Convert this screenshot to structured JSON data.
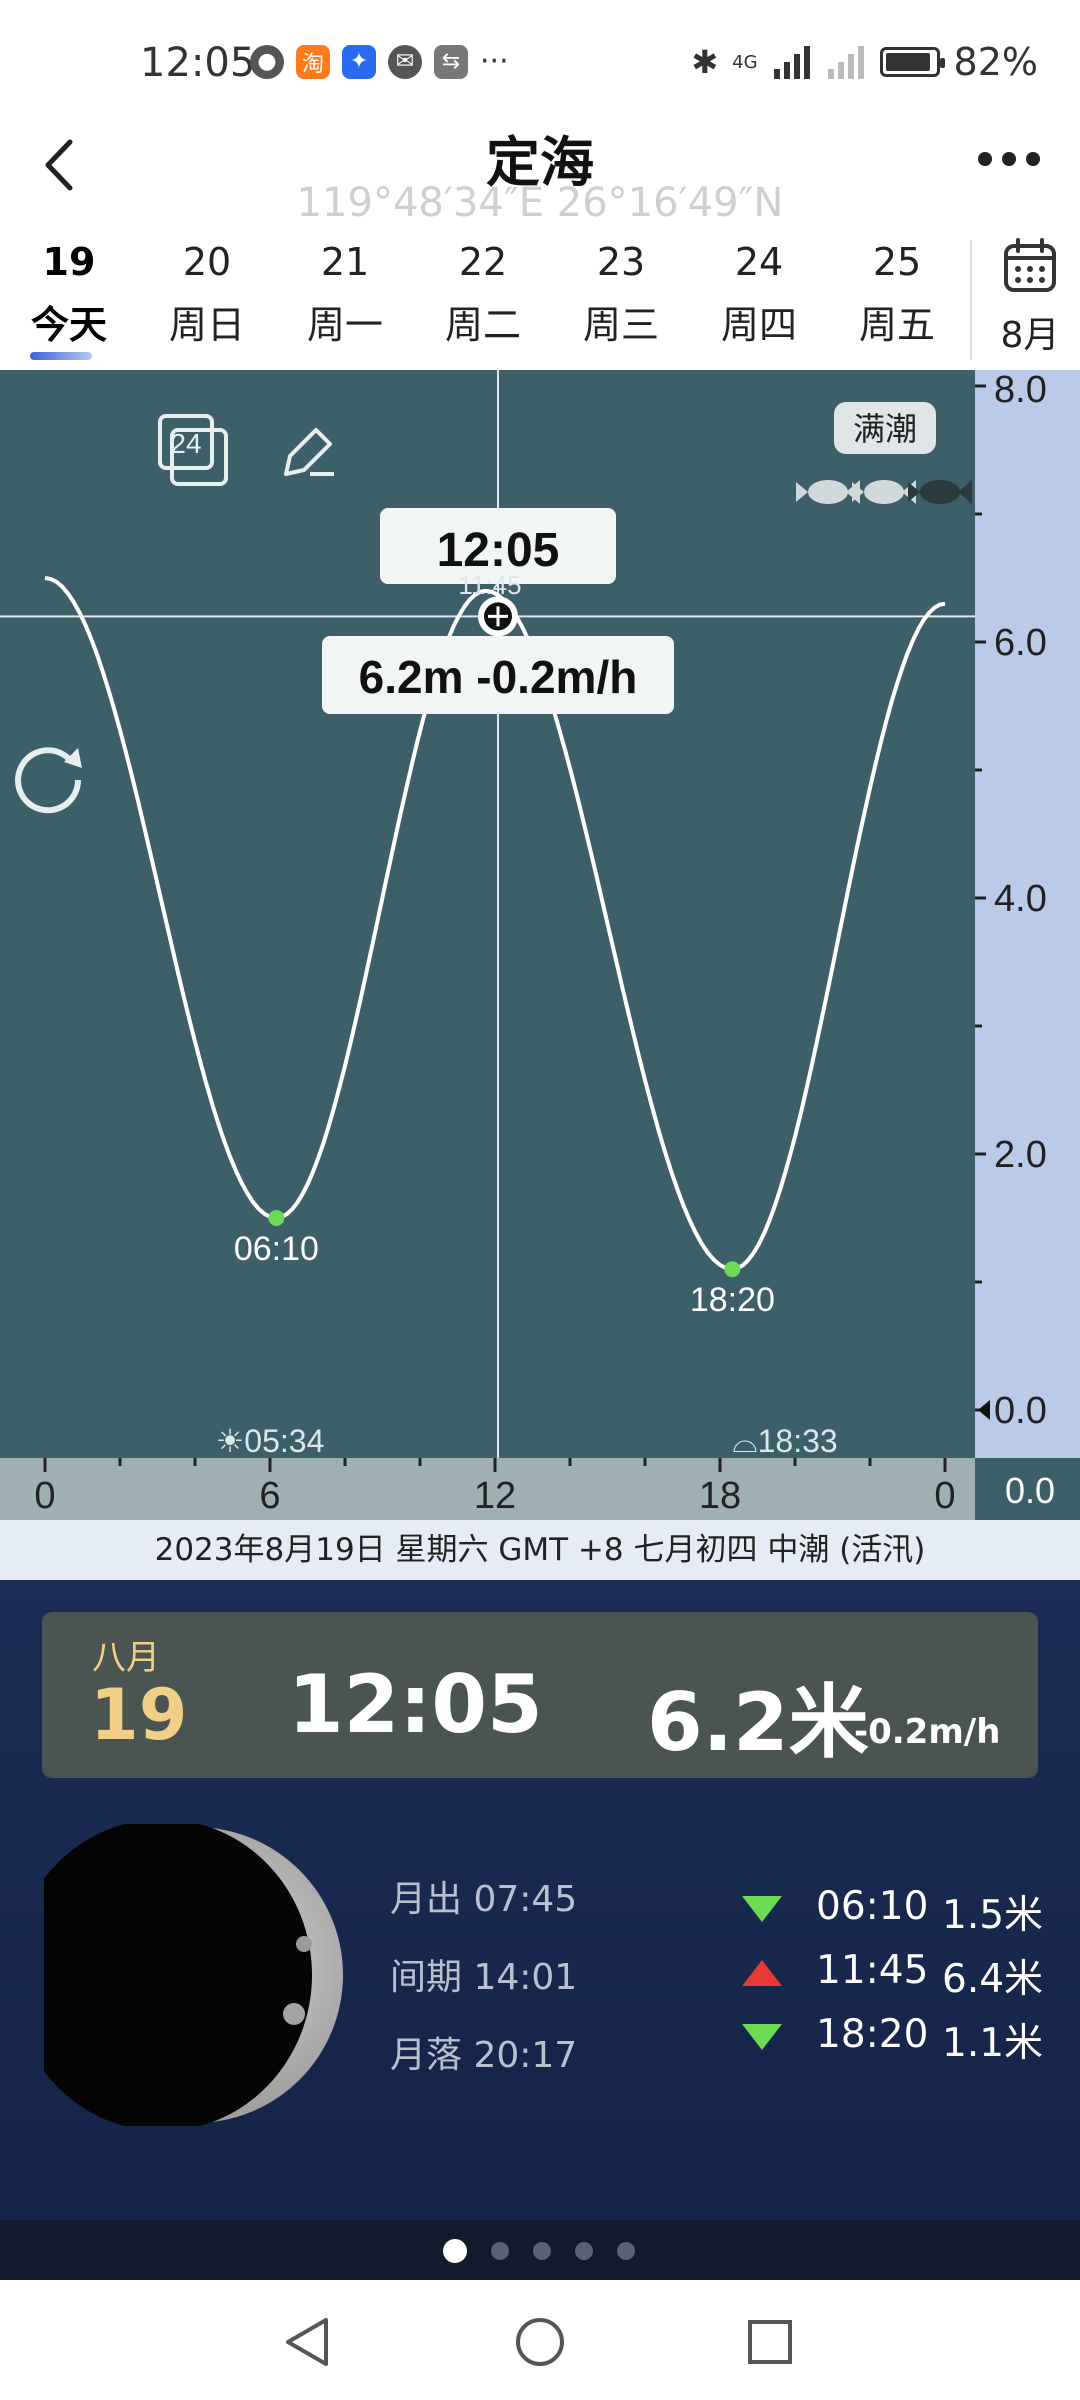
{
  "status": {
    "time": "12:05",
    "more": "···",
    "signal": "4G",
    "battery": "82%",
    "battery_level": 0.82
  },
  "header": {
    "title": "定海",
    "coords": "119°48′34″E   26°16′49″N"
  },
  "days": [
    {
      "num": "19",
      "wk": "今天",
      "selected": true
    },
    {
      "num": "20",
      "wk": "周日"
    },
    {
      "num": "21",
      "wk": "周一"
    },
    {
      "num": "22",
      "wk": "周二"
    },
    {
      "num": "23",
      "wk": "周三"
    },
    {
      "num": "24",
      "wk": "周四"
    },
    {
      "num": "25",
      "wk": "周五"
    }
  ],
  "calendar": {
    "month": "8月"
  },
  "chart": {
    "full_tide_badge": "满潮",
    "refresh_icon_text": "24",
    "cursor_time": "12:05",
    "cursor_under_label": "11:45",
    "cursor_value": "6.2m  -0.2m/h",
    "sunrise": "05:34",
    "sunset": "18:33",
    "right_bottom_value": "0.0",
    "colors": {
      "chart_bg": "#3d5f6a",
      "axis_bg": "#b9cbe6",
      "xaxis_bg": "#9fb0b5",
      "low_point": "#6edb54"
    }
  },
  "chart_data": {
    "type": "line",
    "x_unit": "hour",
    "xlim": [
      0,
      24
    ],
    "ylim": [
      0,
      8
    ],
    "x_ticks": [
      "0",
      "6",
      "12",
      "18",
      "0"
    ],
    "y_ticks": [
      "8.0",
      "6.0",
      "4.0",
      "2.0",
      "0.0"
    ],
    "extremes": [
      {
        "t": 0.0,
        "h": 6.5
      },
      {
        "t": 6.17,
        "h": 1.5,
        "label": "06:10",
        "type": "low"
      },
      {
        "t": 11.75,
        "h": 6.4,
        "type": "high"
      },
      {
        "t": 18.33,
        "h": 1.1,
        "label": "18:20",
        "type": "low"
      },
      {
        "t": 24.0,
        "h": 6.3
      }
    ],
    "cursor": {
      "t": 12.08,
      "h": 6.2
    }
  },
  "info_line": "2023年8月19日  星期六  GMT +8  七月初四  中潮 (活汛)",
  "card": {
    "month": "八月",
    "day": "19",
    "time": "12:05",
    "height": "6.2米",
    "rate": "-0.2m/h"
  },
  "moon": {
    "rise": "月出 07:45",
    "period": "间期 14:01",
    "set": "月落 20:17",
    "illumination_phase": "waxing-crescent"
  },
  "tides": [
    {
      "type": "low",
      "time": "06:10",
      "height": "1.5米"
    },
    {
      "type": "high",
      "time": "11:45",
      "height": "6.4米"
    },
    {
      "type": "low",
      "time": "18:20",
      "height": "1.1米"
    }
  ],
  "pager": {
    "count": 5,
    "active": 0
  }
}
